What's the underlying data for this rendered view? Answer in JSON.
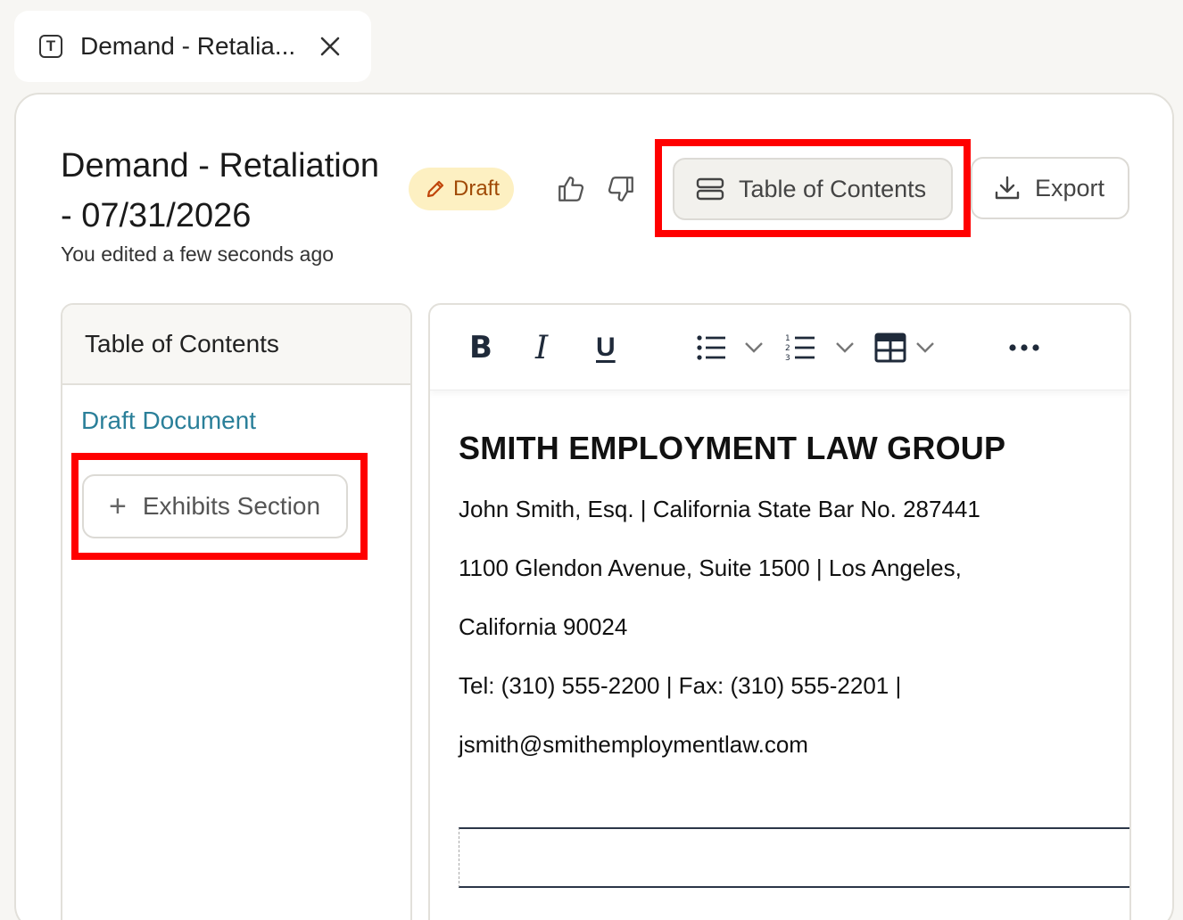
{
  "tab": {
    "title": "Demand - Retalia...",
    "doc_icon_letter": "T"
  },
  "header": {
    "title": "Demand - Retaliation - 07/31/2026",
    "subtitle": "You edited a few seconds ago",
    "status_badge": "Draft"
  },
  "actions": {
    "toc_label": "Table of Contents",
    "export_label": "Export"
  },
  "toc": {
    "header": "Table of Contents",
    "link": "Draft Document",
    "add_section_label": "Exhibits Section"
  },
  "document": {
    "firm_name": "SMITH EMPLOYMENT LAW GROUP",
    "lines": [
      "John Smith, Esq.  |  California State Bar No. 287441",
      "1100 Glendon Avenue, Suite 1500  |  Los Angeles,",
      "California 90024",
      "Tel: (310) 555-2200  |  Fax: (310) 555-2201  |",
      "jsmith@smithemploymentlaw.com"
    ]
  },
  "colors": {
    "highlight": "#ff0000",
    "badge_bg": "#fdf0c2",
    "badge_text": "#a04a06",
    "link": "#2a7f99"
  }
}
